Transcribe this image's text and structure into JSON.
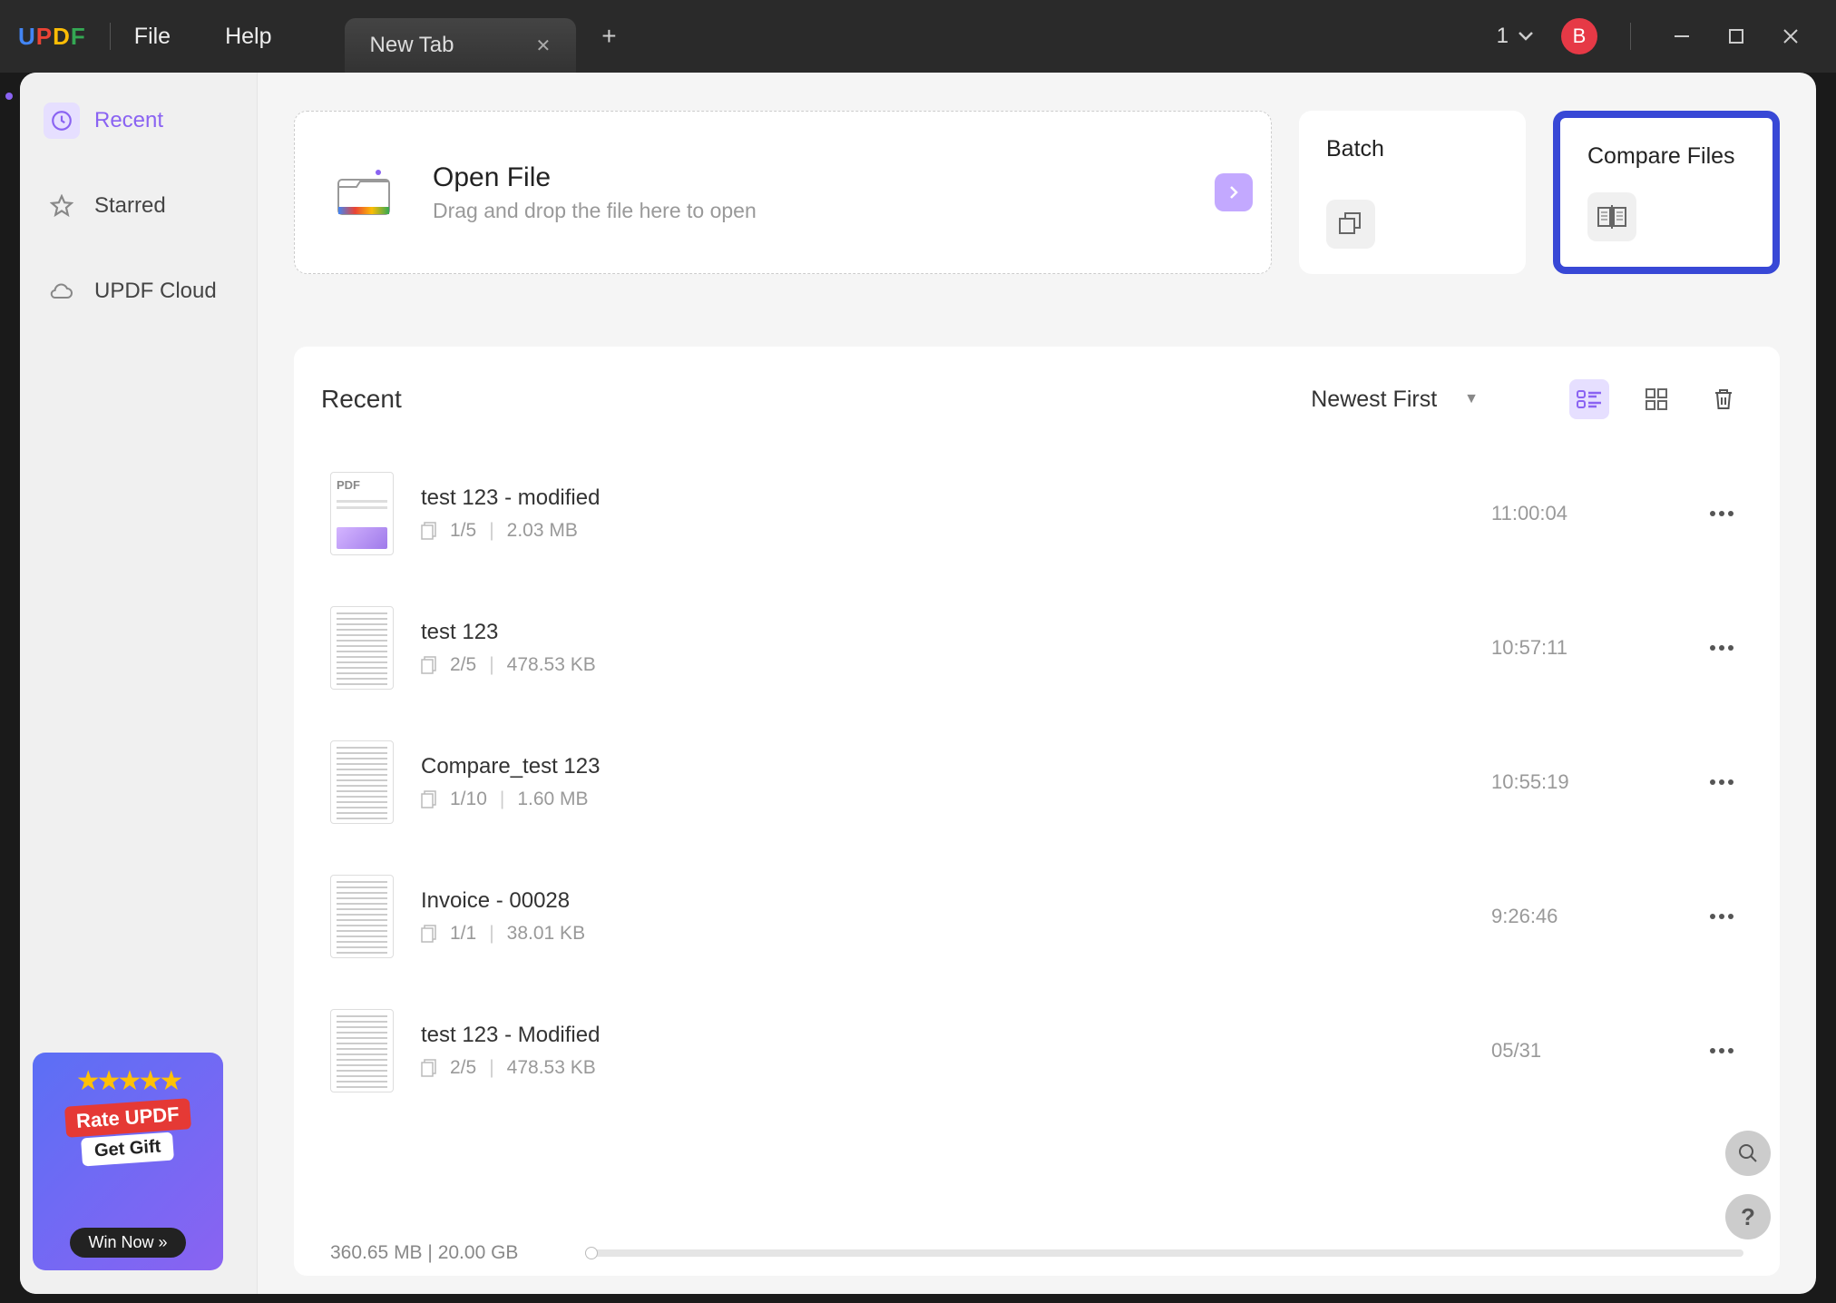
{
  "titlebar": {
    "logo_text": "UPDF",
    "file_menu": "File",
    "help_menu": "Help",
    "tab_title": "New Tab",
    "count": "1",
    "avatar_letter": "B"
  },
  "sidebar": {
    "recent": "Recent",
    "starred": "Starred",
    "cloud": "UPDF Cloud",
    "promo": {
      "rate": "Rate UPDF",
      "gift": "Get Gift",
      "win": "Win Now  »"
    }
  },
  "main": {
    "open_title": "Open File",
    "open_subtitle": "Drag and drop the file here to open",
    "batch": "Batch",
    "compare": "Compare Files",
    "recent_title": "Recent",
    "sort": "Newest First"
  },
  "files": [
    {
      "name": "test 123 - modified",
      "pages": "1/5",
      "size": "2.03 MB",
      "time": "11:00:04",
      "thumb": "pdf"
    },
    {
      "name": "test 123",
      "pages": "2/5",
      "size": "478.53 KB",
      "time": "10:57:11",
      "thumb": "text"
    },
    {
      "name": "Compare_test 123",
      "pages": "1/10",
      "size": "1.60 MB",
      "time": "10:55:19",
      "thumb": "text"
    },
    {
      "name": "Invoice - 00028",
      "pages": "1/1",
      "size": "38.01 KB",
      "time": "9:26:46",
      "thumb": "text"
    },
    {
      "name": "test 123 - Modified",
      "pages": "2/5",
      "size": "478.53 KB",
      "time": "05/31",
      "thumb": "text"
    }
  ],
  "storage": {
    "used": "360.65 MB",
    "sep": " | ",
    "total": "20.00 GB"
  }
}
